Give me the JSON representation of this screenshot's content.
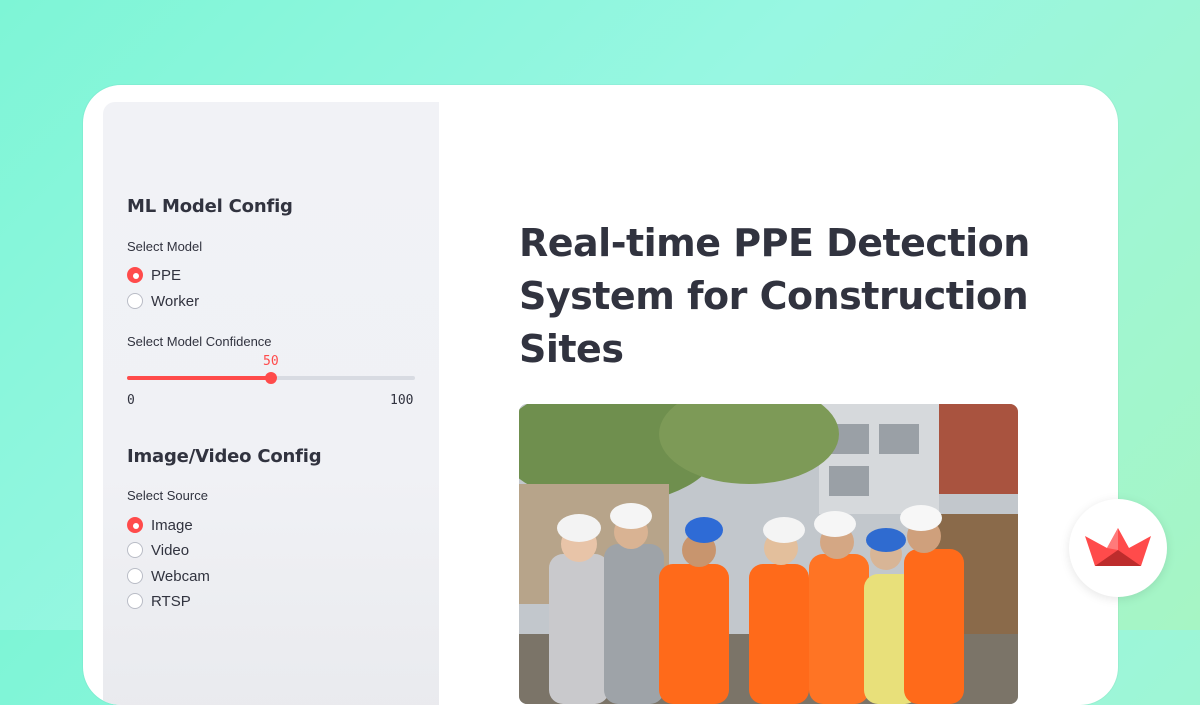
{
  "sidebar": {
    "model_heading": "ML Model Config",
    "select_model_label": "Select Model",
    "models": [
      {
        "label": "PPE",
        "selected": true
      },
      {
        "label": "Worker",
        "selected": false
      }
    ],
    "confidence_label": "Select Model Confidence",
    "confidence": {
      "value": "50",
      "min": "0",
      "max": "100",
      "fraction": 0.5
    },
    "source_heading": "Image/Video Config",
    "select_source_label": "Select Source",
    "sources": [
      {
        "label": "Image",
        "selected": true
      },
      {
        "label": "Video",
        "selected": false
      },
      {
        "label": "Webcam",
        "selected": false
      },
      {
        "label": "RTSP",
        "selected": false
      }
    ]
  },
  "main": {
    "title": "Real-time PPE Detection System for Construction Sites"
  },
  "colors": {
    "accent": "#ff4b4b",
    "text": "#31333f",
    "sidebar_bg": "#f0f2f6"
  },
  "icons": {
    "badge": "streamlit-crown-logo-icon"
  }
}
